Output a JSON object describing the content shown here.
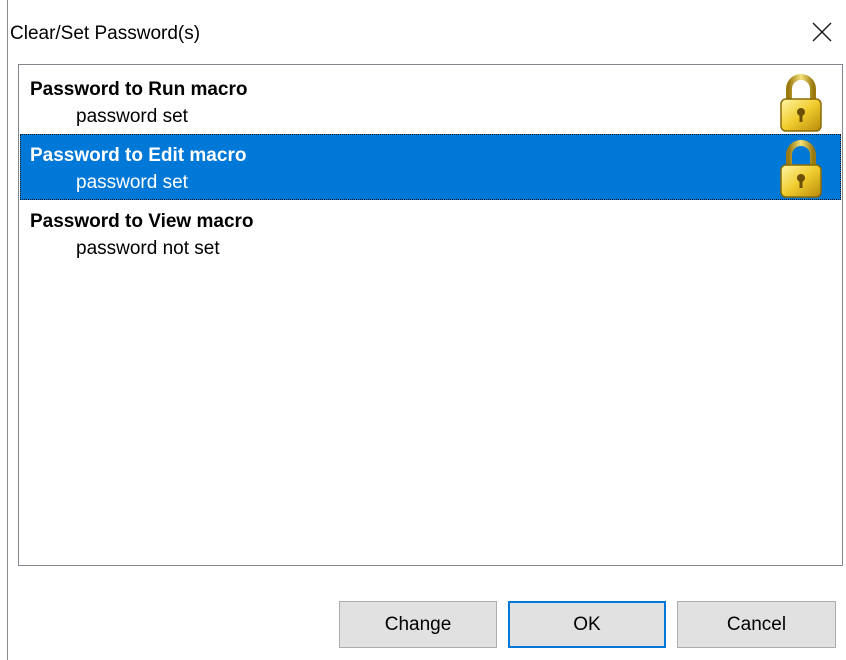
{
  "window": {
    "title": "Clear/Set Password(s)",
    "close_label": "×"
  },
  "list": {
    "items": [
      {
        "title": "Password to Run macro",
        "status": "password set",
        "icon": "lock-icon",
        "selected": false
      },
      {
        "title": "Password to Edit macro",
        "status": "password set",
        "icon": "lock-icon",
        "selected": true
      },
      {
        "title": "Password to View macro",
        "status": "password not set",
        "icon": null,
        "selected": false
      }
    ]
  },
  "buttons": {
    "change": "Change",
    "ok": "OK",
    "cancel": "Cancel"
  },
  "colors": {
    "selection": "#0078d7",
    "button_face": "#e1e1e1",
    "default_button_border": "#0078d7",
    "lock_gold": "#e8c020"
  }
}
